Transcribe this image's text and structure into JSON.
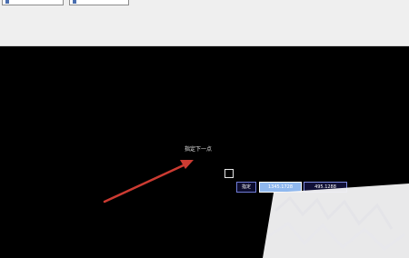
{
  "toolbar": {
    "field_a_value": "",
    "field_b_value": ""
  },
  "drawing": {
    "caption_text": "指定下一点",
    "arrow_color": "#cc3b32",
    "crosshair_icon": "pickbox-icon"
  },
  "dynamic_input": {
    "prompt_label": "指定",
    "x_value": "1345.1728",
    "y_value": "495.1288"
  },
  "colors": {
    "canvas_background": "#000000",
    "toolbar_background": "#efefef",
    "input_highlight": "#8fb8ee",
    "input_border": "#7d8ae0"
  }
}
